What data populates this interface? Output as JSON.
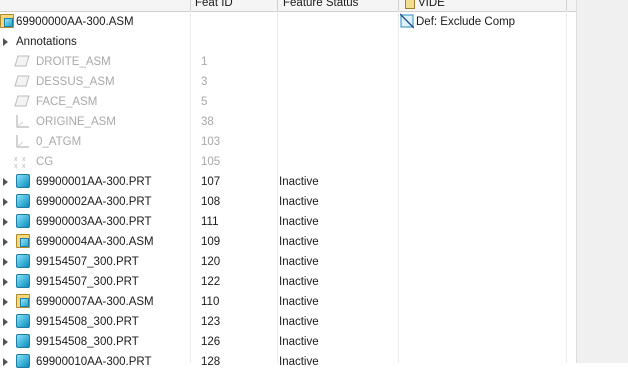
{
  "header": {
    "feat_id": "Feat ID",
    "feature_status": "Feature Status",
    "vide": "VIDE"
  },
  "root": {
    "label": "69900000AA-300.ASM",
    "vide_value": "Def: Exclude Comp"
  },
  "annotations_label": "Annotations",
  "datums": [
    {
      "label": "DROITE_ASM",
      "id": "1",
      "icon": "datum-plane-icon"
    },
    {
      "label": "DESSUS_ASM",
      "id": "3",
      "icon": "datum-plane-icon"
    },
    {
      "label": "FACE_ASM",
      "id": "5",
      "icon": "datum-plane-icon"
    },
    {
      "label": "ORIGINE_ASM",
      "id": "38",
      "icon": "coordinate-system-icon"
    },
    {
      "label": "0_ATGM",
      "id": "103",
      "icon": "coordinate-system-icon"
    },
    {
      "label": "CG",
      "id": "105",
      "icon": "point-icon"
    }
  ],
  "components": [
    {
      "label": "69900001AA-300.PRT",
      "id": "107",
      "status": "Inactive",
      "icon": "part-icon"
    },
    {
      "label": "69900002AA-300.PRT",
      "id": "108",
      "status": "Inactive",
      "icon": "part-icon"
    },
    {
      "label": "69900003AA-300.PRT",
      "id": "111",
      "status": "Inactive",
      "icon": "part-icon"
    },
    {
      "label": "69900004AA-300.ASM",
      "id": "109",
      "status": "Inactive",
      "icon": "assembly-icon"
    },
    {
      "label": "99154507_300.PRT",
      "id": "120",
      "status": "Inactive",
      "icon": "part-icon"
    },
    {
      "label": "99154507_300.PRT",
      "id": "122",
      "status": "Inactive",
      "icon": "part-icon"
    },
    {
      "label": "69900007AA-300.ASM",
      "id": "110",
      "status": "Inactive",
      "icon": "assembly-icon"
    },
    {
      "label": "99154508_300.PRT",
      "id": "123",
      "status": "Inactive",
      "icon": "part-icon"
    },
    {
      "label": "99154508_300.PRT",
      "id": "126",
      "status": "Inactive",
      "icon": "part-icon"
    },
    {
      "label": "69900010AA-300.PRT",
      "id": "128",
      "status": "Inactive",
      "icon": "part-icon"
    }
  ]
}
